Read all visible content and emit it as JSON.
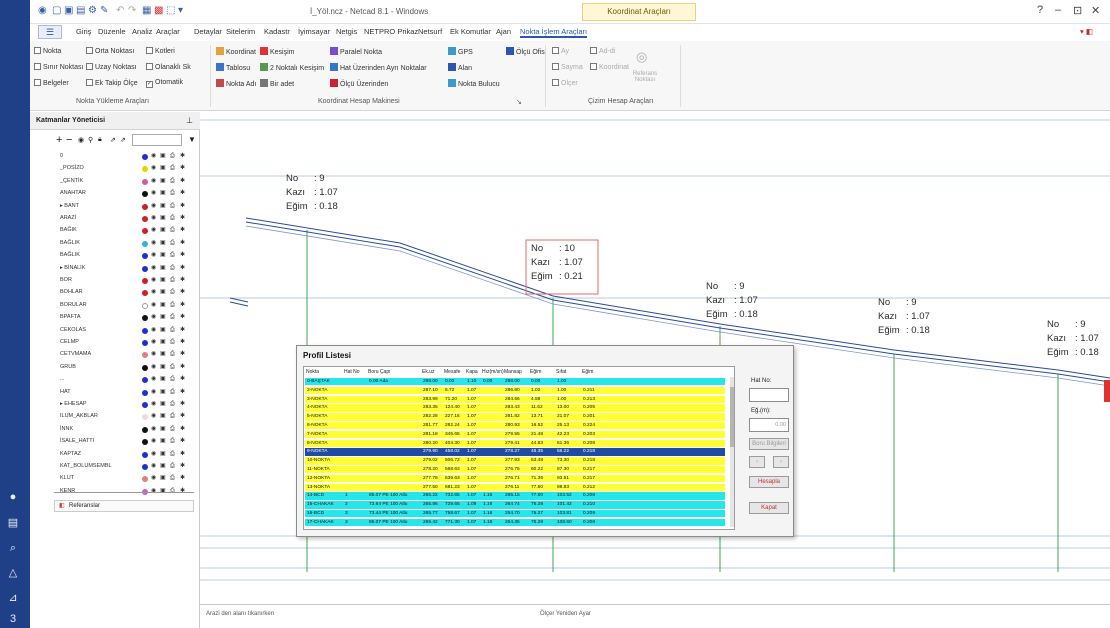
{
  "window": {
    "title": "İ_Yöl.ncz - Netcad 8.1 - Windows",
    "context_tab": "Koordinat Araçları",
    "controls": [
      "?",
      "–",
      "⊡",
      "✕"
    ]
  },
  "tabs": [
    {
      "label": "Giriş",
      "active": false
    },
    {
      "label": "Düzenle",
      "active": false
    },
    {
      "label": "Analiz",
      "active": false
    },
    {
      "label": "Araçlar",
      "active": false
    },
    {
      "label": "Detaylar",
      "active": false
    },
    {
      "label": "Sitelerim",
      "active": false
    },
    {
      "label": "Kadastr",
      "active": false
    },
    {
      "label": "İyimsayar",
      "active": false
    },
    {
      "label": "Netgis",
      "active": false
    },
    {
      "label": "NETPRO Prikaz",
      "active": false
    },
    {
      "label": "Netsurf",
      "active": false
    },
    {
      "label": "Ek Komutlar",
      "active": false
    },
    {
      "label": "Ajan",
      "active": false
    },
    {
      "label": "Nokta İşlem Araçları",
      "active": true
    }
  ],
  "ribbon": {
    "group1": {
      "items": [
        {
          "label": "Nokta",
          "checked": false
        },
        {
          "label": "Sınır Noktası",
          "checked": false
        },
        {
          "label": "Belgeler",
          "checked": false
        },
        {
          "label": "Orta Noktası",
          "checked": false
        },
        {
          "label": "Uzay Noktası",
          "checked": false
        },
        {
          "label": "Ek Takip Ölçe",
          "checked": false
        },
        {
          "label": "Kotleri",
          "checked": false
        },
        {
          "label": "Olanaklı Sk",
          "checked": false
        },
        {
          "label": "Otomatik",
          "checked": true
        }
      ],
      "label": "Nokta Yükleme Araçları"
    },
    "group2": {
      "items": [
        "Koordinat",
        "Tablosu",
        "Nokta Adı",
        "Kesişim",
        "2 Noktalı Kesişim",
        "Bir adet",
        "Paralel Nokta",
        "Hat Üzerinden Ayrı Noktalar",
        "Ölçü Üzerinden",
        "GPS",
        "Alan",
        "Nokta Bulucu",
        "Ölçü Ofis"
      ],
      "label": "Koordinat Hesap Makinesi"
    },
    "group3": {
      "items": [
        "Ay",
        "Ad-di",
        "Sayma",
        "Koordinat",
        "Olçer",
        "Referans Noktası"
      ],
      "label": "Çizim Hesap Araçları"
    }
  },
  "layer_panel": {
    "title": "Katmanlar Yöneticisi",
    "layers": [
      {
        "name": "0",
        "color": "#1f2fd6"
      },
      {
        "name": "_POSİZO",
        "color": "#e7d400"
      },
      {
        "name": "_ÇENTİK",
        "color": "#d45aa3"
      },
      {
        "name": "ANAHTAR",
        "color": "#111111"
      },
      {
        "name": "▸ BANT",
        "color": "#d02020"
      },
      {
        "name": "ARAZİ",
        "color": "#d02020"
      },
      {
        "name": "BAĞIK",
        "color": "#d02020"
      },
      {
        "name": "BAĞLIK",
        "color": "#2ab9d6"
      },
      {
        "name": "BAĞLIK",
        "color": "#1f2fd6"
      },
      {
        "name": "▸ BİNALIK",
        "color": "#1f2fd6"
      },
      {
        "name": "BOR",
        "color": "#d02020"
      },
      {
        "name": "BOHLAR",
        "color": "#d02020"
      },
      {
        "name": "BORULAR",
        "color": "#ffffff"
      },
      {
        "name": "BPAFTA",
        "color": "#111111"
      },
      {
        "name": "CEKOLAS",
        "color": "#1f2fd6"
      },
      {
        "name": "CELMP",
        "color": "#1f2fd6"
      },
      {
        "name": "CETVMAMA",
        "color": "#e07f7f"
      },
      {
        "name": "GRUB",
        "color": "#111111"
      },
      {
        "name": "...",
        "color": "#1f2fd6"
      },
      {
        "name": "HAT",
        "color": "#1f2fd6"
      },
      {
        "name": "▸ EHESAP",
        "color": "#1f2fd6"
      },
      {
        "name": "ILUM_AKBLAR",
        "color": "#f1d9d9"
      },
      {
        "name": "İNNK",
        "color": "#111111"
      },
      {
        "name": "İSALE_HATTI",
        "color": "#111111"
      },
      {
        "name": "KAPTAZ",
        "color": "#1f2fd6"
      },
      {
        "name": "KAT_BOLUMSEMBL",
        "color": "#1f2fd6"
      },
      {
        "name": "KLUT",
        "color": "#e07f7f"
      },
      {
        "name": "KENR",
        "color": "#c063d4"
      }
    ],
    "footer_item": "Referanslar"
  },
  "profile_labels": [
    {
      "no": "9",
      "kazi": "1.07",
      "egim": "0.18",
      "boxed": false
    },
    {
      "no": "10",
      "kazi": "1.07",
      "egim": "0.21",
      "boxed": true
    },
    {
      "no": "9",
      "kazi": "1.07",
      "egim": "0.18",
      "boxed": false
    },
    {
      "no": "9",
      "kazi": "1.07",
      "egim": "0.18",
      "boxed": false
    },
    {
      "no": "9",
      "kazi": "1.07",
      "egim": "0.18",
      "boxed": false
    }
  ],
  "label_keys": {
    "no": "No",
    "kazi": "Kazı",
    "egim": "Eğim",
    "sep": ":"
  },
  "dialog": {
    "title": "Profil Listesi",
    "columns": [
      "Nokta",
      "Hat No",
      "Boru Çapı",
      "Ek.uz",
      "Mesafe",
      "Kapa",
      "Hız(m/sn)",
      "Mansap",
      "Eğim",
      "Sıfat",
      "Eğim"
    ],
    "rows": [
      {
        "c": [
          "0-BAŞTAK",
          "",
          "0.00 Ada",
          "288.00",
          "0.00",
          "1.10",
          "0.00",
          "288.00",
          "0.00",
          "1.00",
          ""
        ],
        "bg": "cyan"
      },
      {
        "c": [
          "2-NOKTA",
          "",
          "",
          "287.10",
          "6.72",
          "1.07",
          "",
          "286.80",
          "1.02",
          "1.00",
          "0.211"
        ],
        "bg": "yellow"
      },
      {
        "c": [
          "3-NOKTA",
          "",
          "",
          "283.99",
          "71.20",
          "1.07",
          "",
          "284.66",
          "4.58",
          "1.00",
          "0.213"
        ],
        "bg": "yellow"
      },
      {
        "c": [
          "4-NOKTA",
          "",
          "",
          "283.35",
          "124.40",
          "1.07",
          "",
          "283.43",
          "11.52",
          "13.00",
          "0.205"
        ],
        "bg": "yellow"
      },
      {
        "c": [
          "5-NOKTA",
          "",
          "",
          "282.28",
          "227.16",
          "1.07",
          "",
          "281.82",
          "13.71",
          "21.07",
          "0.201"
        ],
        "bg": "yellow"
      },
      {
        "c": [
          "6-NOKTA",
          "",
          "",
          "281.77",
          "282.24",
          "1.07",
          "",
          "280.93",
          "16.52",
          "25.13",
          "0.224"
        ],
        "bg": "yellow"
      },
      {
        "c": [
          "7-NOKTA",
          "",
          "",
          "281.18",
          "345.65",
          "1.07",
          "",
          "279.55",
          "21.48",
          "42.23",
          "0.203"
        ],
        "bg": "yellow"
      },
      {
        "c": [
          "8-NOKTA",
          "",
          "",
          "280.20",
          "404.30",
          "1.07",
          "",
          "279.41",
          "44.83",
          "51.36",
          "0.208"
        ],
        "bg": "yellow"
      },
      {
        "c": [
          "9-NOKTA",
          "",
          "",
          "279.90",
          "458.02",
          "1.07",
          "",
          "278.27",
          "48.35",
          "56.22",
          "0.218"
        ],
        "bg": "selected"
      },
      {
        "c": [
          "10-NOKTA",
          "",
          "",
          "279.02",
          "506.72",
          "1.07",
          "",
          "277.93",
          "53.48",
          "73.30",
          "0.218"
        ],
        "bg": "yellow"
      },
      {
        "c": [
          "11-NOKTA",
          "",
          "",
          "278.20",
          "568.63",
          "1.07",
          "",
          "276.75",
          "60.22",
          "87.30",
          "0.217"
        ],
        "bg": "yellow"
      },
      {
        "c": [
          "12-NOKTA",
          "",
          "",
          "277.78",
          "639.63",
          "1.07",
          "",
          "276.71",
          "71.36",
          "93.51",
          "0.217"
        ],
        "bg": "yellow"
      },
      {
        "c": [
          "13-NOKTA",
          "",
          "",
          "277.50",
          "681.23",
          "1.07",
          "",
          "276.11",
          "77.60",
          "98.83",
          "0.212"
        ],
        "bg": "yellow"
      },
      {
        "c": [
          "14-BCD",
          "1",
          "85.07 PE 100 Atlu",
          "266.22",
          "732.65",
          "1.07",
          "1.16",
          "265.15",
          "77.60",
          "103.52",
          "0.208"
        ],
        "bg": "cyan"
      },
      {
        "c": [
          "15-CHAKAK",
          "2",
          "73.64 PE 100 Atlu",
          "265.86",
          "729.65",
          "1.09",
          "1.16",
          "264.74",
          "75.28",
          "101.42",
          "0.210"
        ],
        "bg": "cyan"
      },
      {
        "c": [
          "16-BCD",
          "3",
          "73.44 PE 100 Atlu",
          "265.77",
          "758.67",
          "1.07",
          "1.16",
          "264.70",
          "75.27",
          "103.81",
          "0.209"
        ],
        "bg": "cyan"
      },
      {
        "c": [
          "17-CHAKAK",
          "3",
          "85.07 PE 100 Atlu",
          "265.42",
          "771.30",
          "1.07",
          "1.16",
          "264.35",
          "75.28",
          "108.60",
          "0.208"
        ],
        "bg": "cyan"
      }
    ],
    "side": {
      "hat_no_label": "Hat No:",
      "egim_label": "Eğ.(m):",
      "egim_value": "0.00",
      "buttons": [
        {
          "label": "Boru Bilgileri",
          "style": "dis"
        },
        {
          "label": "‹",
          "style": "dis"
        },
        {
          "label": "›",
          "style": "dis"
        },
        {
          "label": "Hesapla",
          "style": "red"
        },
        {
          "label": "Kapat",
          "style": "red"
        }
      ]
    }
  },
  "status": {
    "left": "Arazi den alanı tıkanırken",
    "mid": "Ölçer Yeniden Ayar"
  },
  "colors": {
    "accent": "#2b57b0",
    "frame": "#1f3f86",
    "row_yellow": "#ffff33",
    "row_cyan": "#26e6ea",
    "row_selected": "#1f4aa8",
    "profile_line": "#2b4a9a",
    "grid_green": "#3fa84a"
  }
}
